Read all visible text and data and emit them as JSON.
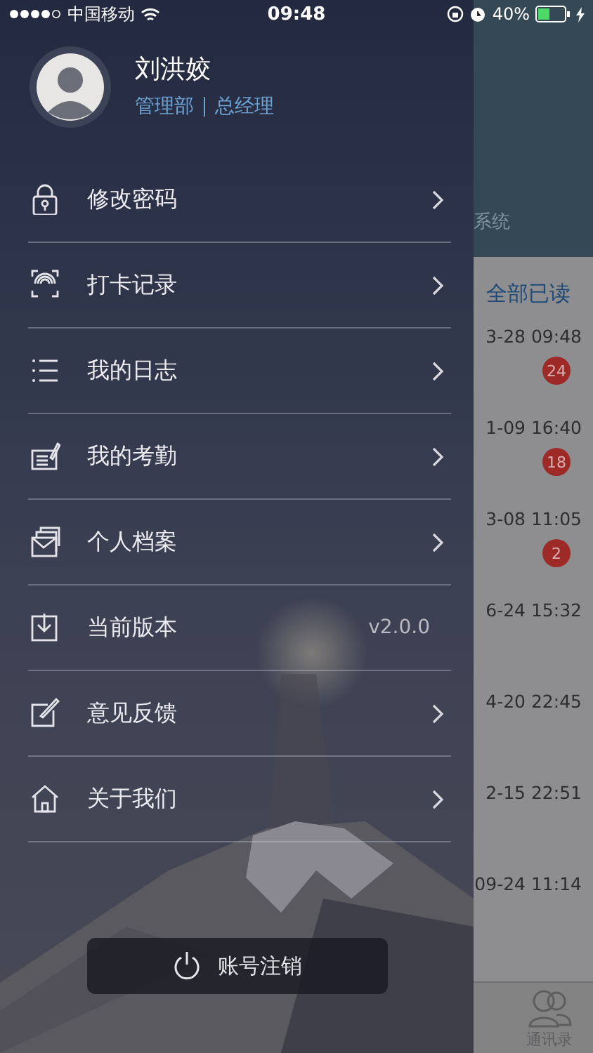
{
  "status_bar": {
    "carrier": "中国移动",
    "time": "09:48",
    "battery": "40%"
  },
  "drawer": {
    "profile": {
      "name": "刘洪姣",
      "department": "管理部",
      "position": "总经理"
    },
    "menu": [
      {
        "label": "修改密码",
        "kind": "link"
      },
      {
        "label": "打卡记录",
        "kind": "link"
      },
      {
        "label": "我的日志",
        "kind": "link"
      },
      {
        "label": "我的考勤",
        "kind": "link"
      },
      {
        "label": "个人档案",
        "kind": "link"
      },
      {
        "label": "当前版本",
        "kind": "value",
        "value": "v2.0.0"
      },
      {
        "label": "意见反馈",
        "kind": "link"
      },
      {
        "label": "关于我们",
        "kind": "link"
      }
    ],
    "logout_button": "账号注销"
  },
  "background_screen": {
    "header": "系统",
    "mark_all_read": "全部已读",
    "rows": [
      {
        "time": "3-28 09:48",
        "badge": "24"
      },
      {
        "time": "1-09 16:40",
        "badge": "18"
      },
      {
        "time": "3-08 11:05",
        "badge": "2"
      },
      {
        "time": "6-24 15:32"
      },
      {
        "time": "4-20 22:45"
      },
      {
        "time": "2-15 22:51"
      },
      {
        "time": "09-24 11:14"
      }
    ],
    "tab_bar": [
      {
        "label": "通讯录"
      }
    ]
  }
}
